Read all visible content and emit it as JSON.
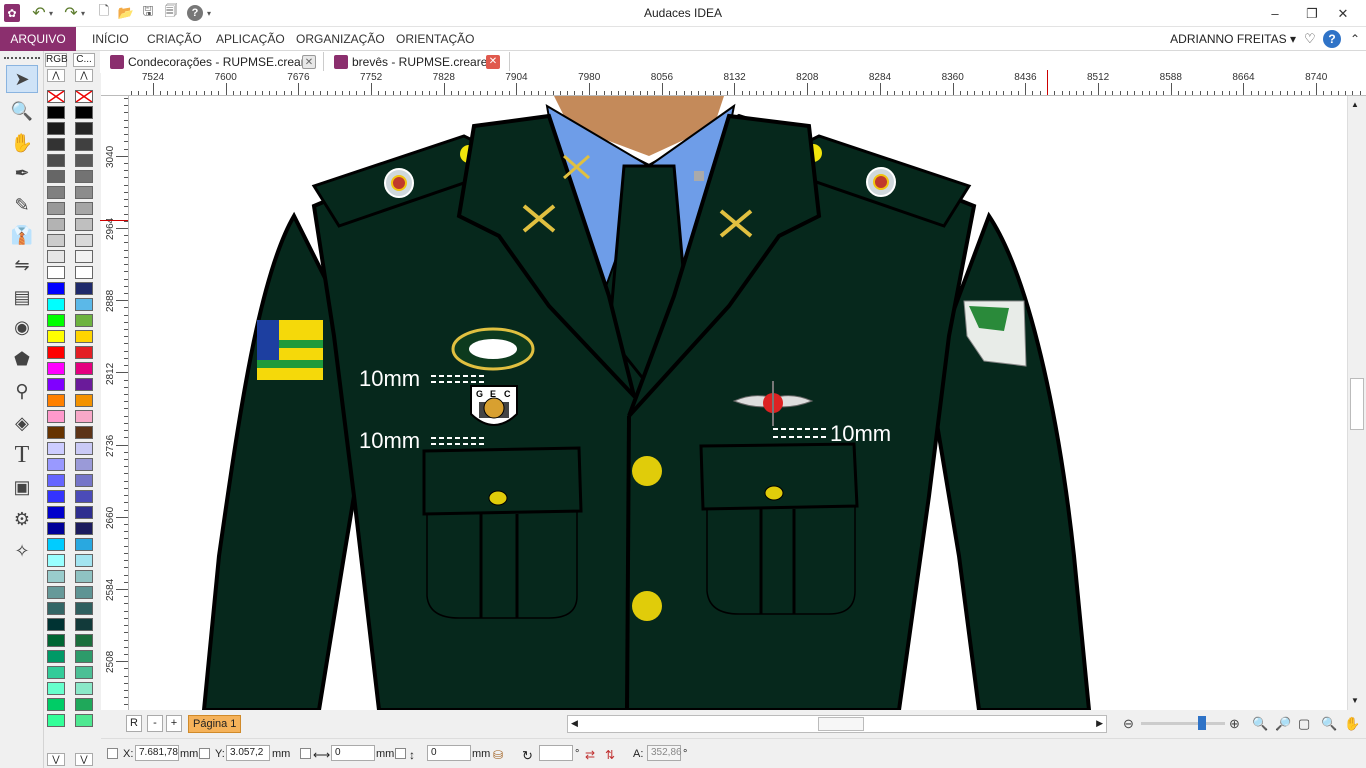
{
  "window": {
    "title": "Audaces IDEA",
    "minimize": "–",
    "maximize": "❐",
    "close": "✕"
  },
  "quick_access": [
    {
      "name": "app-logo-icon",
      "glyph": "✿"
    },
    {
      "name": "undo-icon",
      "glyph": "↶"
    },
    {
      "name": "redo-icon",
      "glyph": "↷"
    },
    {
      "name": "new-file-icon",
      "glyph": "🗋"
    },
    {
      "name": "open-folder-icon",
      "glyph": "📂"
    },
    {
      "name": "save-icon",
      "glyph": "🖫"
    },
    {
      "name": "print-preview-icon",
      "glyph": "🗐"
    },
    {
      "name": "help-icon",
      "glyph": "?"
    }
  ],
  "menu": {
    "items": [
      "ARQUIVO",
      "INÍCIO",
      "CRIAÇÃO",
      "APLICAÇÃO",
      "ORGANIZAÇÃO",
      "ORIENTAÇÃO"
    ],
    "user": "ADRIANNO FREITAS",
    "user_caret": "▾",
    "favorite_glyph": "♡",
    "help_glyph": "?",
    "collapse_glyph": "⌃"
  },
  "tabs": [
    {
      "label": "Condecorações - RUPMSE.creare",
      "close": "✕",
      "active": false
    },
    {
      "label": "brevês - RUPMSE.creare *",
      "close": "✕",
      "active": true
    }
  ],
  "palette": {
    "header_left": "RGB",
    "header_right": "C...",
    "left_colors": [
      "#000000",
      "#1a1a1a",
      "#333333",
      "#4d4d4d",
      "#666666",
      "#808080",
      "#999999",
      "#b3b3b3",
      "#cccccc",
      "#e6e6e6",
      "#ffffff",
      "#0000ff",
      "#00ffff",
      "#00ff00",
      "#ffff00",
      "#ff0000",
      "#ff00ff",
      "#8000ff",
      "#ff8000",
      "#ff99cc",
      "#663300",
      "#ccccff",
      "#9999ff",
      "#6666ff",
      "#3333ff",
      "#0000cc",
      "#000099",
      "#00ccff",
      "#99ffff",
      "#99cccc",
      "#669999",
      "#336666",
      "#003333",
      "#006633",
      "#009966",
      "#33cc99",
      "#66ffcc",
      "#00cc66",
      "#33ff99"
    ],
    "right_colors": [
      "#000000",
      "#262626",
      "#404040",
      "#595959",
      "#737373",
      "#8c8c8c",
      "#a6a6a6",
      "#bfbfbf",
      "#d9d9d9",
      "#f2f2f2",
      "#ffffff",
      "#1f2a6b",
      "#5bb8e8",
      "#6db33f",
      "#ffd400",
      "#e31e24",
      "#e4007f",
      "#6a1b9a",
      "#f39200",
      "#f7a8c8",
      "#5c3317",
      "#c9c9f5",
      "#9a9ad8",
      "#7575c8",
      "#4b4bb8",
      "#2e2e8f",
      "#1c1c5e",
      "#29a8e0",
      "#a3e4f0",
      "#8fc2c2",
      "#5e9494",
      "#2f5f5f",
      "#123a3a",
      "#1b6e3c",
      "#2d9b6a",
      "#4cbf95",
      "#8ae8c8",
      "#1fa85a",
      "#4ee891"
    ]
  },
  "ruler": {
    "unit": "mm",
    "h_labels": [
      "7524",
      "7600",
      "7676",
      "7752",
      "7828",
      "7904",
      "7980",
      "8056",
      "8132",
      "8208",
      "8284",
      "8360",
      "8436",
      "8512",
      "8588",
      "8664",
      "8740"
    ],
    "v_labels": [
      "3040",
      "2964",
      "2888",
      "2812",
      "2736",
      "2660",
      "2584",
      "2508"
    ]
  },
  "canvas": {
    "annotation_left_top": "10mm",
    "annotation_left_bottom": "10mm",
    "annotation_right": "10mm",
    "gec_letters": [
      "G",
      "E",
      "C"
    ]
  },
  "pagebar": {
    "r_label": "R",
    "minus": "-",
    "plus": "+",
    "page": "Página 1",
    "left_arrow": "◀",
    "right_arrow": "▶"
  },
  "status": {
    "x_label": "X:",
    "x_value": "7.681,78",
    "x_unit": "mm",
    "y_label": "Y:",
    "y_value": "3.057,2",
    "y_unit": "mm",
    "w_value": "0",
    "w_unit": "mm",
    "h_value": "0",
    "h_unit": "mm",
    "rot_value": "",
    "rot_unit": "°",
    "a_label": "A:",
    "a_value": "352,86",
    "a_unit": "°"
  },
  "zoom_level_fraction": 0.73
}
